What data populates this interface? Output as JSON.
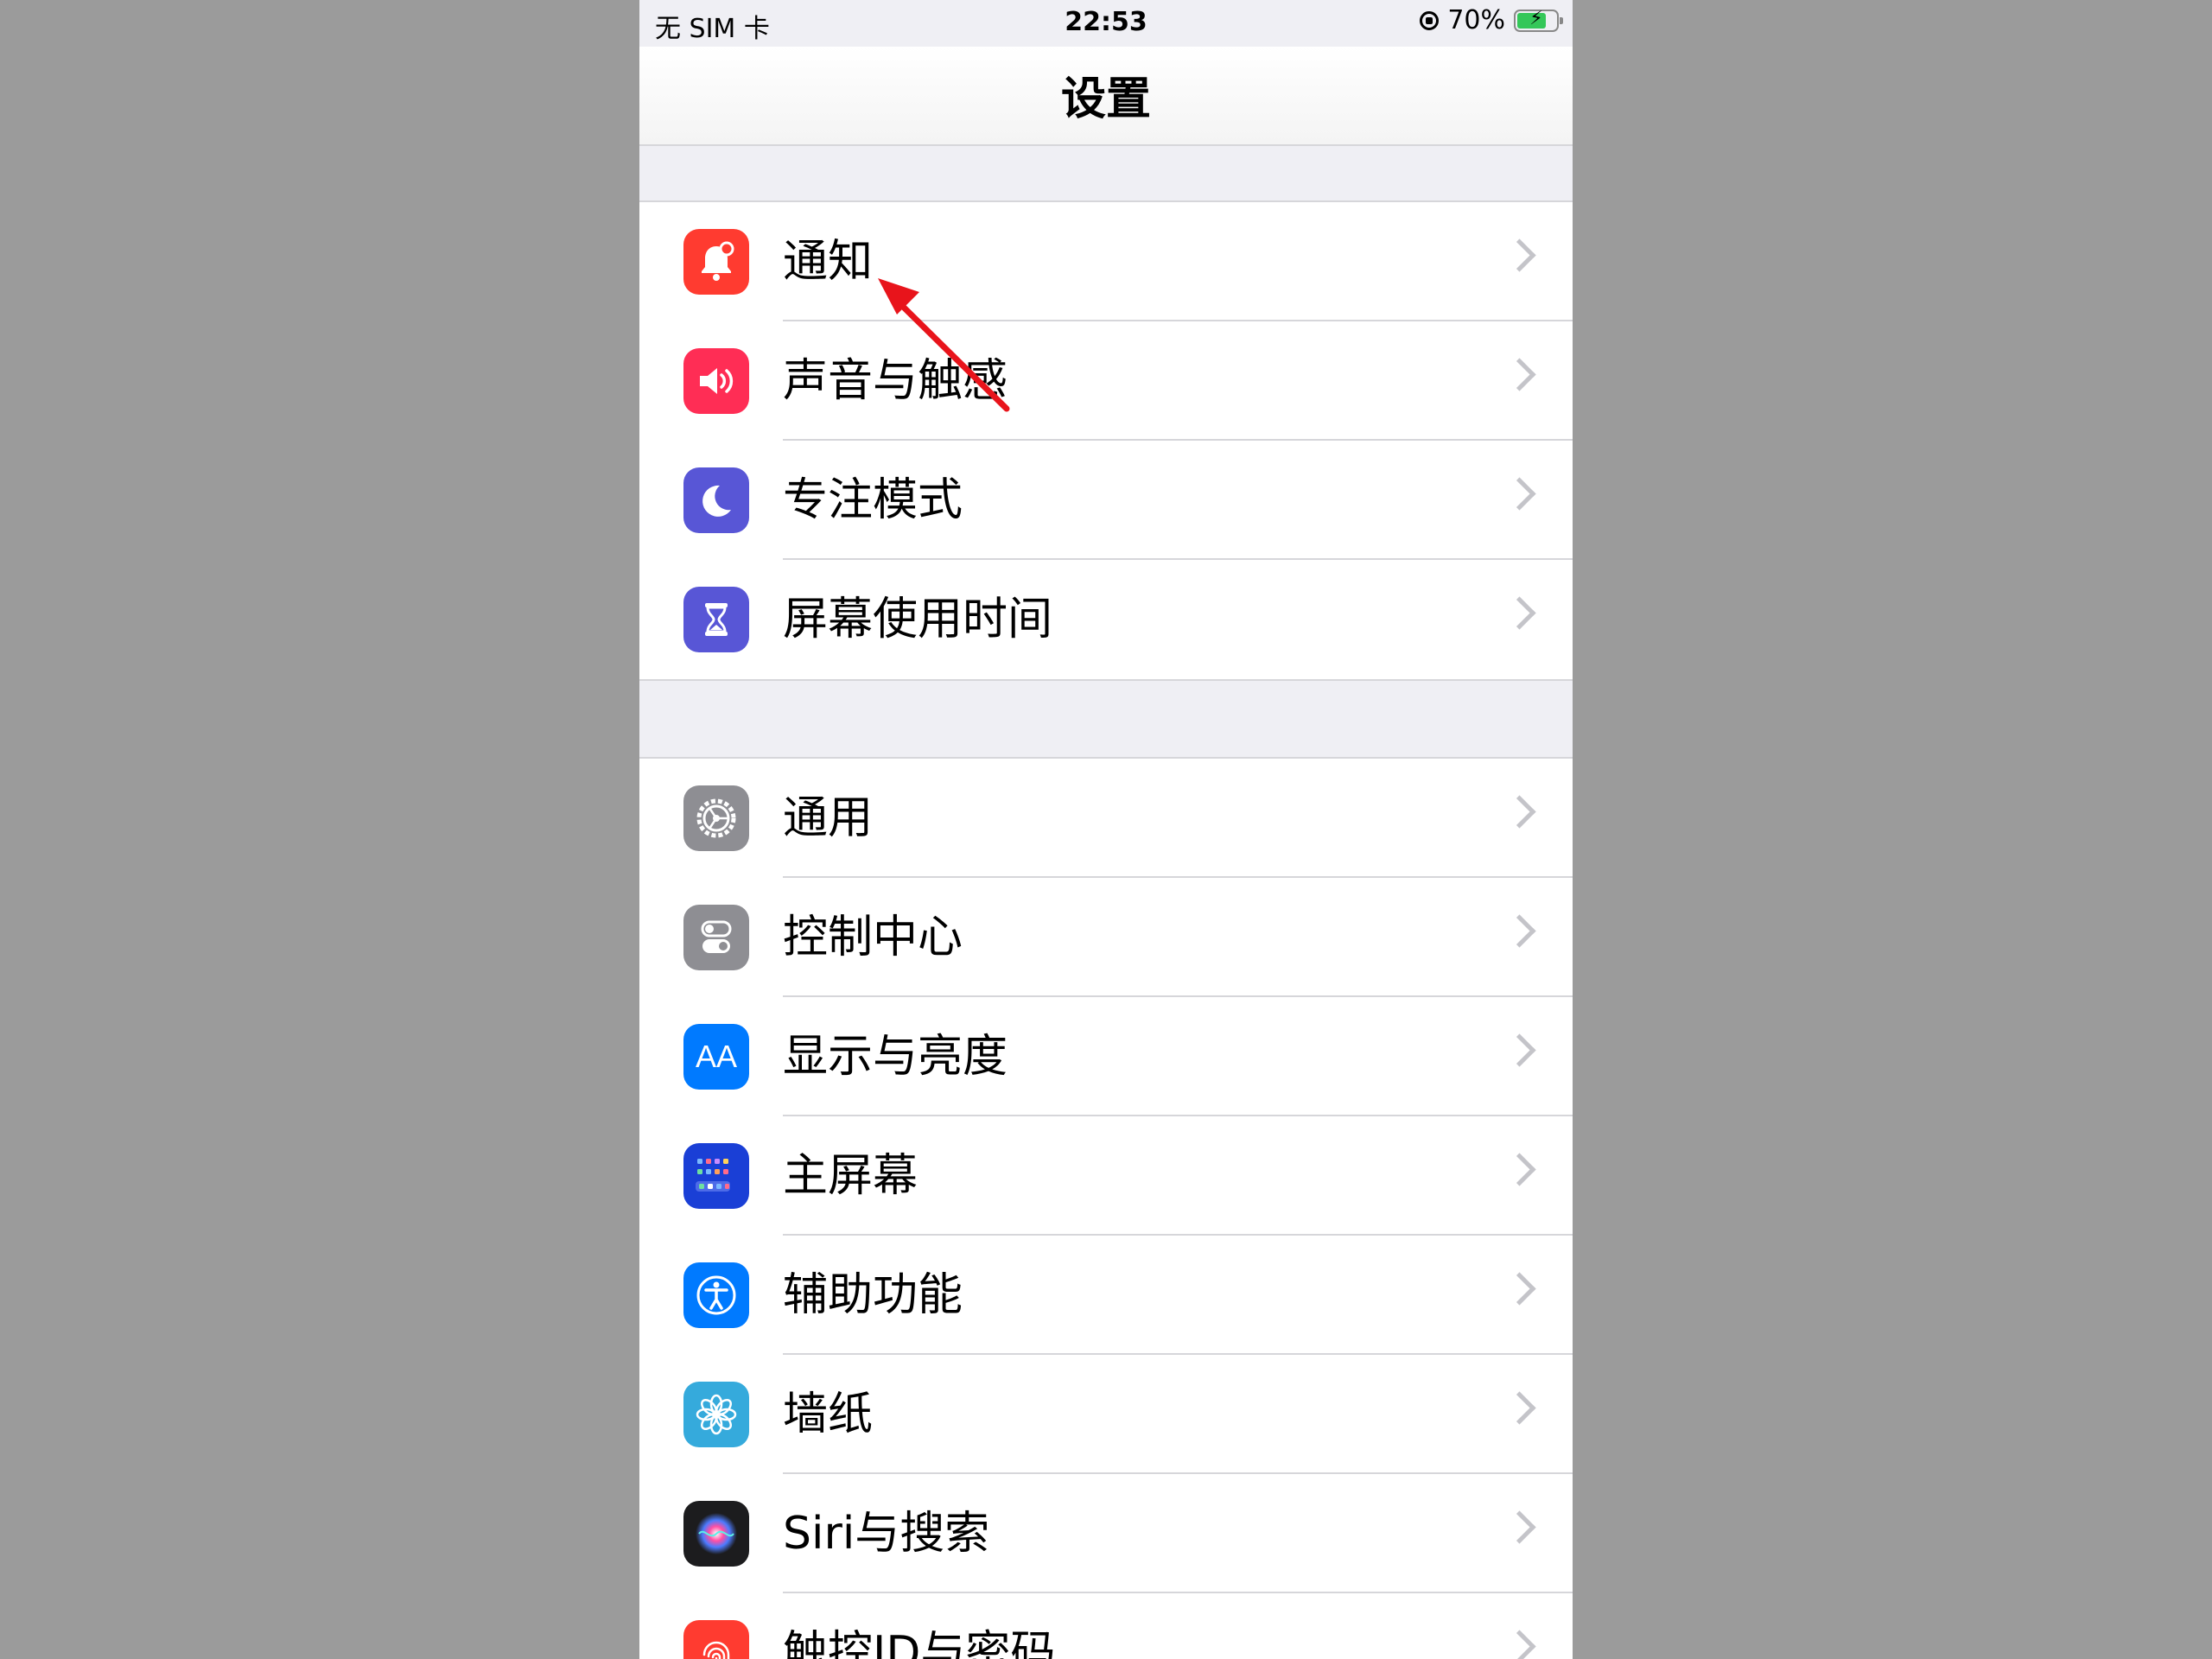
{
  "status_bar": {
    "carrier": "无 SIM 卡",
    "time": "22:53",
    "battery_percent": "70%",
    "battery_level": 0.7
  },
  "nav": {
    "title": "设置"
  },
  "groups": [
    {
      "items": [
        {
          "label": "通知",
          "icon": "bell-icon",
          "color": "#ff3b30"
        },
        {
          "label": "声音与触感",
          "icon": "speaker-icon",
          "color": "#ff2d55"
        },
        {
          "label": "专注模式",
          "icon": "moon-icon",
          "color": "#5856d6"
        },
        {
          "label": "屏幕使用时间",
          "icon": "hourglass-icon",
          "color": "#5856d6"
        }
      ]
    },
    {
      "items": [
        {
          "label": "通用",
          "icon": "gear-icon",
          "color": "#8e8e93"
        },
        {
          "label": "控制中心",
          "icon": "toggles-icon",
          "color": "#8e8e93"
        },
        {
          "label": "显示与亮度",
          "icon": "text-size-icon",
          "icon_text": "AA",
          "color": "#007aff"
        },
        {
          "label": "主屏幕",
          "icon": "home-grid-icon",
          "color": "#1a3fd6"
        },
        {
          "label": "辅助功能",
          "icon": "accessibility-icon",
          "color": "#007aff"
        },
        {
          "label": "墙纸",
          "icon": "flower-icon",
          "color": "#35aadc"
        },
        {
          "label": "Siri与搜索",
          "icon": "siri-icon",
          "color": "#1c1c1e"
        },
        {
          "label": "触控ID与密码",
          "icon": "fingerprint-icon",
          "color": "#ff3b30"
        }
      ]
    }
  ],
  "annotation": {
    "type": "red-arrow",
    "points_to": "通知",
    "color": "#e8141b"
  }
}
